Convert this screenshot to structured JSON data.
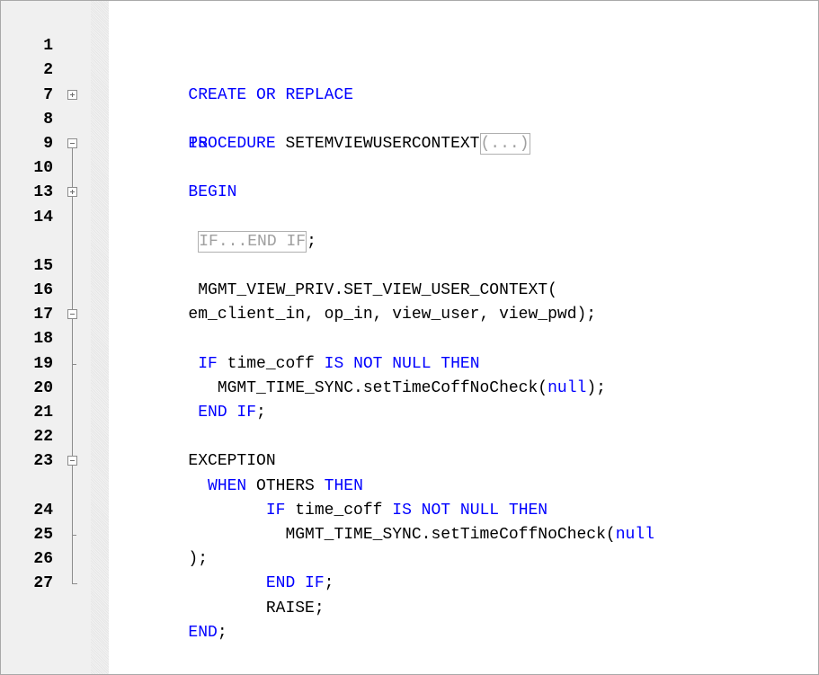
{
  "editor": {
    "lines": [
      {
        "num": "1",
        "parts": [
          {
            "t": "CREATE ",
            "c": "kw"
          },
          {
            "t": "OR ",
            "c": "kw"
          },
          {
            "t": "REPLACE",
            "c": "kw"
          }
        ]
      },
      {
        "num": "2",
        "parts": [
          {
            "t": "PROCEDURE ",
            "c": "kw"
          },
          {
            "t": "SETEMVIEWUSERCONTEXT",
            "c": "ident"
          },
          {
            "t": "(...)",
            "c": "collapsed"
          }
        ]
      },
      {
        "num": "7",
        "parts": [
          {
            "t": "IS",
            "c": "kw"
          }
        ]
      },
      {
        "num": "8",
        "parts": [
          {
            "t": "BEGIN",
            "c": "kw"
          }
        ]
      },
      {
        "num": "9",
        "parts": []
      },
      {
        "num": "10",
        "parts": [
          {
            "t": " ",
            "c": "ident"
          },
          {
            "t": "IF...END IF",
            "c": "collapsed"
          },
          {
            "t": ";",
            "c": "ident"
          }
        ]
      },
      {
        "num": "13",
        "parts": []
      },
      {
        "num": "14",
        "parts": [
          {
            "t": " MGMT_VIEW_PRIV.SET_VIEW_USER_CONTEXT(",
            "c": "ident"
          }
        ]
      },
      {
        "num": "",
        "parts": [
          {
            "t": "em_client_in, op_in, view_user, view_pwd);",
            "c": "ident"
          }
        ]
      },
      {
        "num": "15",
        "parts": []
      },
      {
        "num": "16",
        "parts": [
          {
            "t": " IF ",
            "c": "kw"
          },
          {
            "t": "time_coff ",
            "c": "ident"
          },
          {
            "t": "IS NOT NULL THEN",
            "c": "kw"
          }
        ]
      },
      {
        "num": "17",
        "parts": [
          {
            "t": "   MGMT_TIME_SYNC.setTimeCoffNoCheck(",
            "c": "ident"
          },
          {
            "t": "null",
            "c": "kw"
          },
          {
            "t": ");",
            "c": "ident"
          }
        ]
      },
      {
        "num": "18",
        "parts": [
          {
            "t": " END IF",
            "c": "kw"
          },
          {
            "t": ";",
            "c": "ident"
          }
        ]
      },
      {
        "num": "19",
        "parts": []
      },
      {
        "num": "20",
        "parts": [
          {
            "t": "EXCEPTION",
            "c": "ident"
          }
        ]
      },
      {
        "num": "21",
        "parts": [
          {
            "t": "  WHEN ",
            "c": "kw"
          },
          {
            "t": "OTHERS ",
            "c": "ident"
          },
          {
            "t": "THEN",
            "c": "kw"
          }
        ]
      },
      {
        "num": "22",
        "parts": [
          {
            "t": "        IF ",
            "c": "kw"
          },
          {
            "t": "time_coff ",
            "c": "ident"
          },
          {
            "t": "IS NOT NULL THEN",
            "c": "kw"
          }
        ]
      },
      {
        "num": "23",
        "parts": [
          {
            "t": "          MGMT_TIME_SYNC.setTimeCoffNoCheck(",
            "c": "ident"
          },
          {
            "t": "null",
            "c": "kw"
          }
        ]
      },
      {
        "num": "",
        "parts": [
          {
            "t": ");",
            "c": "ident"
          }
        ]
      },
      {
        "num": "24",
        "parts": [
          {
            "t": "        END IF",
            "c": "kw"
          },
          {
            "t": ";",
            "c": "ident"
          }
        ]
      },
      {
        "num": "25",
        "parts": [
          {
            "t": "        RAISE;",
            "c": "ident"
          }
        ]
      },
      {
        "num": "26",
        "parts": [
          {
            "t": "END",
            "c": "kw"
          },
          {
            "t": ";",
            "c": "ident"
          }
        ]
      },
      {
        "num": "27",
        "parts": []
      }
    ]
  }
}
